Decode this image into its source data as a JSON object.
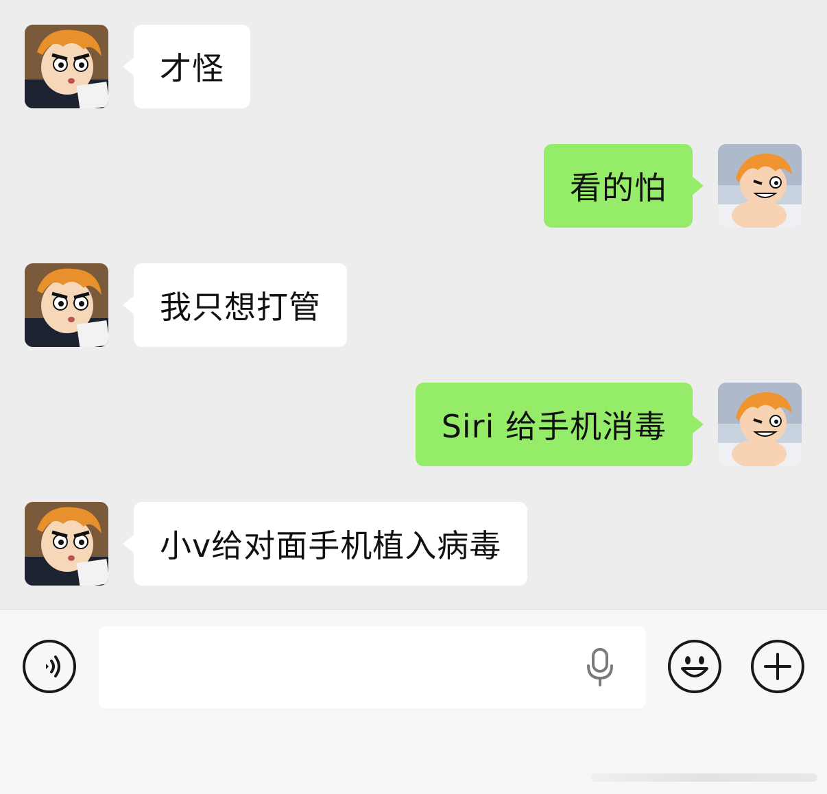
{
  "messages": [
    {
      "side": "in",
      "text": "才怪"
    },
    {
      "side": "out",
      "text": "看的怕"
    },
    {
      "side": "in",
      "text": "我只想打管"
    },
    {
      "side": "out",
      "text": "Siri 给手机消毒"
    },
    {
      "side": "in",
      "text": "小v给对面手机植入病毒"
    }
  ],
  "input": {
    "value": "",
    "placeholder": ""
  },
  "icons": {
    "voice": "voice-mode-icon",
    "mic": "microphone-icon",
    "emoji": "emoji-icon",
    "plus": "more-plus-icon",
    "avatar_in": "contact-avatar",
    "avatar_out": "self-avatar"
  },
  "colors": {
    "background": "#ededed",
    "bubble_in": "#ffffff",
    "bubble_out": "#95ec69",
    "input_bar": "#f7f7f7"
  }
}
